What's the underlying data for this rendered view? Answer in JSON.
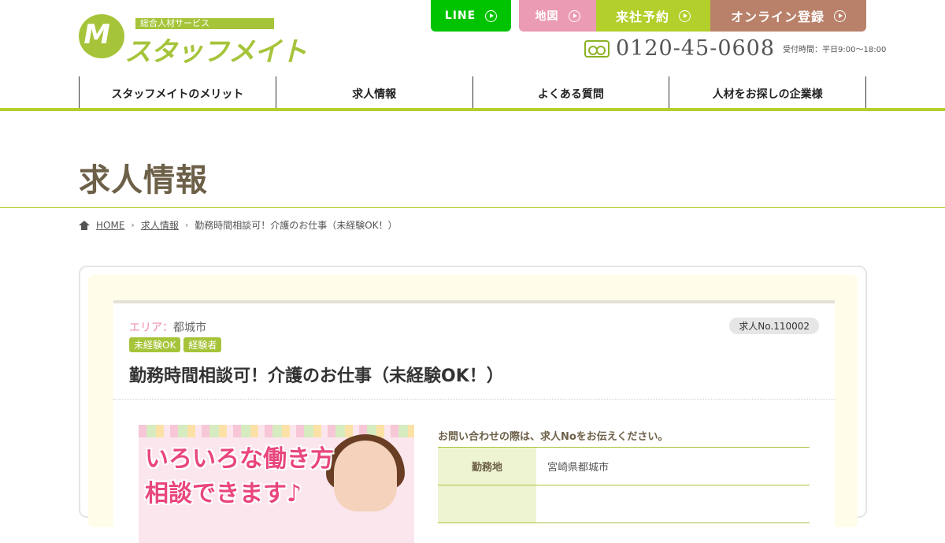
{
  "logo": {
    "tagline": "総合人材サービス",
    "name": "スタッフメイト",
    "mark": "M"
  },
  "header": {
    "buttons": [
      {
        "label": "LINE"
      },
      {
        "label": "地図"
      },
      {
        "label": "来社予約"
      },
      {
        "label": "オンライン登録"
      }
    ],
    "phone": "0120-45-0608",
    "hours": "受付時間：平日9:00～18:00"
  },
  "nav": {
    "items": [
      "スタッフメイトのメリット",
      "求人情報",
      "よくある質問",
      "人材をお探しの企業様"
    ]
  },
  "page": {
    "title": "求人情報"
  },
  "breadcrumb": {
    "home": "HOME",
    "jobs": "求人情報",
    "current": "勤務時間相談可！介護のお仕事（未経験OK！）"
  },
  "job": {
    "area_label": "エリア：",
    "area": "都城市",
    "number": "求人No.110002",
    "tags": [
      "未経験OK",
      "経験者"
    ],
    "title": "勤務時間相談可！介護のお仕事（未経験OK！）",
    "photo_text": [
      "いろいろな働き方",
      "相談できます♪"
    ],
    "notice": "お問い合わせの際は、求人Noをお伝えください。",
    "details": [
      {
        "label": "勤務地",
        "value": "宮崎県都城市"
      },
      {
        "label": "",
        "value": ""
      }
    ]
  },
  "colors": {
    "accent": "#b3cf2c",
    "line": "#00c300",
    "map": "#eb9bb3",
    "online": "#b9816a",
    "heading": "#6d6048",
    "area_label": "#eb8fad"
  }
}
